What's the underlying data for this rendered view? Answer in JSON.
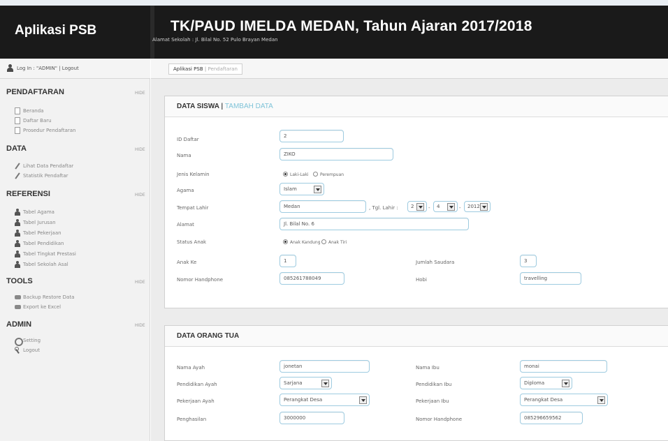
{
  "header": {
    "app_title": "Aplikasi PSB",
    "school_title": "TK/PAUD IMELDA MEDAN, Tahun Ajaran 2017/2018",
    "address": "Alamat Sekolah : Jl. Bilal No. 52 Pulo Brayan Medan"
  },
  "login": {
    "text": "Log In : \"ADMIN\" | Logout"
  },
  "sidebar": {
    "sections": [
      {
        "title": "PENDAFTARAN",
        "hide": "HIDE",
        "items": [
          {
            "label": "Beranda",
            "icon": "document-icon"
          },
          {
            "label": "Daftar Baru",
            "icon": "document-icon"
          },
          {
            "label": "Prosedur Pendaftaran",
            "icon": "document-icon"
          }
        ]
      },
      {
        "title": "DATA",
        "hide": "HIDE",
        "items": [
          {
            "label": "Lihat Data Pendaftar",
            "icon": "pencil-icon"
          },
          {
            "label": "Statistik Pendaftar",
            "icon": "pencil-icon"
          }
        ]
      },
      {
        "title": "REFERENSI",
        "hide": "HIDE",
        "items": [
          {
            "label": "Tabel Agama",
            "icon": "person-icon"
          },
          {
            "label": "Tabel Jurusan",
            "icon": "person-icon"
          },
          {
            "label": "Tabel Pekerjaan",
            "icon": "person-icon"
          },
          {
            "label": "Tabel Pendidikan",
            "icon": "person-icon"
          },
          {
            "label": "Tabel Tingkat Prestasi",
            "icon": "person-icon"
          },
          {
            "label": "Tabel Sekolah Asal",
            "icon": "person-icon"
          }
        ]
      },
      {
        "title": "TOOLS",
        "hide": "HIDE",
        "items": [
          {
            "label": "Backup Restore Data",
            "icon": "database-icon"
          },
          {
            "label": "Export ke Excel",
            "icon": "database-icon"
          }
        ]
      },
      {
        "title": "ADMIN",
        "hide": "HIDE",
        "items": [
          {
            "label": "Setting",
            "icon": "gear-icon"
          },
          {
            "label": "Logout",
            "icon": "key-icon"
          }
        ]
      }
    ]
  },
  "breadcrumb": {
    "home": "Aplikasi PSB",
    "current": "Pendaftaran"
  },
  "data_siswa": {
    "title": "DATA SISWA",
    "add_link": "TAMBAH DATA",
    "id_label": "ID Daftar",
    "id_value": "2",
    "nama_label": "Nama",
    "nama_value": "ZIKO",
    "jk_label": "Jenis Kelamin",
    "jk_options": [
      "Laki-Laki",
      "Perempuan"
    ],
    "agama_label": "Agama",
    "agama_value": "Islam",
    "tempat_label": "Tempat Lahir",
    "tempat_value": "Medan",
    "tgl_label": "Tgl. Lahir",
    "tgl_day": "2",
    "tgl_month": "4",
    "tgl_year": "2012",
    "alamat_label": "Alamat",
    "alamat_value": "Jl. Bilal No. 6",
    "status_label": "Status Anak",
    "status_options": [
      "Anak Kandung",
      "Anak Tiri"
    ],
    "anakke_label": "Anak Ke",
    "anakke_value": "1",
    "saudara_label": "Jumlah Saudara",
    "saudara_value": "3",
    "hp_label": "Nomor Handphone",
    "hp_value": "085261788049",
    "hobi_label": "Hobi",
    "hobi_value": "travelling"
  },
  "data_ortu": {
    "title": "DATA ORANG TUA",
    "ayah_label": "Nama Ayah",
    "ayah_value": "jonetan",
    "ibu_label": "Nama Ibu",
    "ibu_value": "monai",
    "pend_ayah_label": "Pendidikan Ayah",
    "pend_ayah_value": "Sarjana",
    "pend_ibu_label": "Pendidikan Ibu",
    "pend_ibu_value": "Diploma",
    "kerja_ayah_label": "Pekerjaan Ayah",
    "kerja_ayah_value": "Perangkat Desa",
    "kerja_ibu_label": "Pekerjaan Ibu",
    "kerja_ibu_value": "Perangkat Desa",
    "gaji_label": "Penghasilan",
    "gaji_value": "3000000",
    "hp_label": "Nomor Handphone",
    "hp_value": "085296659562"
  },
  "colors": {
    "header_bg": "#1a1a1a",
    "accent": "#7fc3d8",
    "input_border": "#9ecbe0"
  }
}
